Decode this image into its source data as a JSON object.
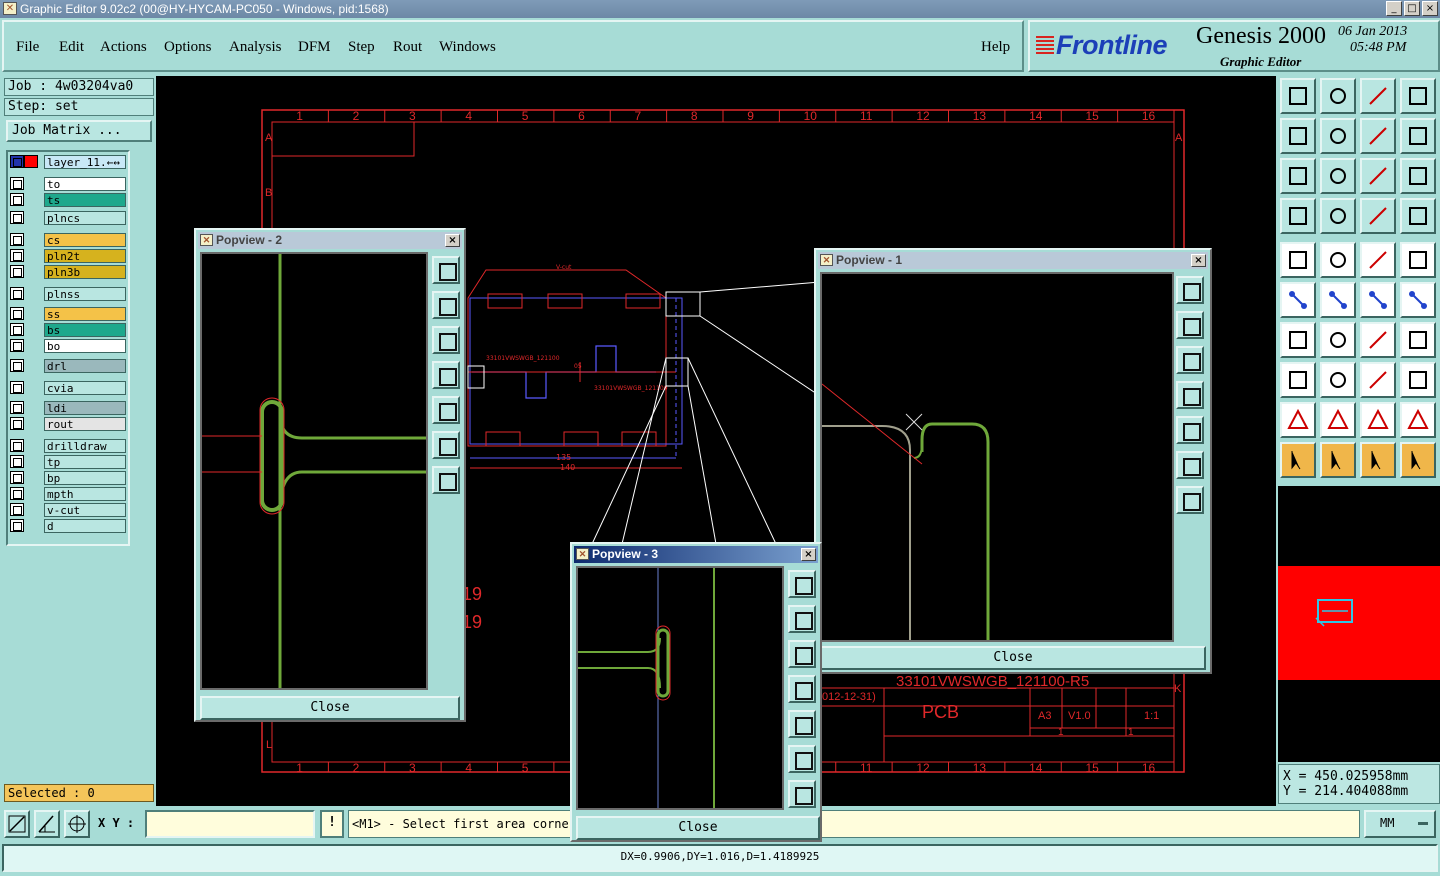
{
  "window": {
    "title": "Graphic Editor 9.02c2 (00@HY-HYCAM-PC050 - Windows, pid:1568)",
    "controls": [
      "_",
      "□",
      "×"
    ]
  },
  "menu": {
    "file": "File",
    "edit": "Edit",
    "actions": "Actions",
    "options": "Options",
    "analysis": "Analysis",
    "dfm": "DFM",
    "step": "Step",
    "rout": "Rout",
    "windows": "Windows",
    "help": "Help"
  },
  "brand": {
    "logo": "Frontline",
    "product": "Genesis 2000",
    "subtitle": "Graphic Editor",
    "date": "06 Jan 2013",
    "time": "05:48 PM"
  },
  "job": {
    "job_label": "Job : 4w03204va0",
    "step_label": "Step: set",
    "matrix_button": "Job Matrix ..."
  },
  "layers": [
    {
      "name": "layer_11.←↔",
      "color": "#c8e8f6"
    },
    {
      "name": "to",
      "color": "#ffffff"
    },
    {
      "name": "ts",
      "color": "#1ea88c"
    },
    {
      "name": "plncs",
      "color": "#b9e6e1"
    },
    {
      "name": "cs",
      "color": "#f4c248"
    },
    {
      "name": "pln2t",
      "color": "#d6b21e"
    },
    {
      "name": "pln3b",
      "color": "#d6b21e"
    },
    {
      "name": "plnss",
      "color": "#b9e6e1"
    },
    {
      "name": "ss",
      "color": "#f4c248"
    },
    {
      "name": "bs",
      "color": "#1ea88c"
    },
    {
      "name": "bo",
      "color": "#ffffff"
    },
    {
      "name": "drl",
      "color": "#9ab8bc"
    },
    {
      "name": "cvia",
      "color": "#b9e6e1"
    },
    {
      "name": "ldi",
      "color": "#9ab8bc"
    },
    {
      "name": "rout",
      "color": "#e4e4e4"
    },
    {
      "name": "drilldraw",
      "color": "#b9e6e1"
    },
    {
      "name": "tp",
      "color": "#b9e6e1"
    },
    {
      "name": "bp",
      "color": "#b9e6e1"
    },
    {
      "name": "mpth",
      "color": "#b9e6e1"
    },
    {
      "name": "v-cut",
      "color": "#b9e6e1"
    },
    {
      "name": "d",
      "color": "#b9e6e1"
    }
  ],
  "status": {
    "selected": "Selected : 0",
    "xy_label": "X Y :",
    "xy_value": "",
    "exclaim": "!",
    "prompt": "<M1> - Select first area corner",
    "units": "MM",
    "measure": "DX=0.9906,DY=1.016,D=1.4189925"
  },
  "coords": {
    "x": "X  =  450.025958mm",
    "y": "Y  =  214.404088mm"
  },
  "drawing": {
    "columns": [
      "1",
      "2",
      "3",
      "4",
      "5",
      "6",
      "7",
      "8",
      "9",
      "10",
      "11",
      "12",
      "13",
      "14",
      "15",
      "16"
    ],
    "bottom_columns": [
      "1",
      "2",
      "3",
      "4",
      "5",
      "11",
      "12",
      "13",
      "14",
      "15",
      "16"
    ],
    "rows_left": [
      "A",
      "B"
    ],
    "rows_right": [
      "A",
      "K"
    ],
    "title_block": {
      "part": "33101VWSWGB_121100-R5",
      "name": "PCB",
      "size": "A3",
      "rev": "V1.0",
      "scale": "1:1",
      "date": "012-12-31)",
      "one_a": "1",
      "one_b": "1"
    },
    "dims": {
      "d1": "135",
      "d2": "140"
    },
    "board_labels": [
      "V-cut",
      "33101VWSWGB_121100",
      "33101VWSWGB_121100",
      "05"
    ],
    "misc": [
      "19",
      "19"
    ]
  },
  "popups": [
    {
      "title": "Popview - 2",
      "close": "Close"
    },
    {
      "title": "Popview - 1",
      "close": "Close"
    },
    {
      "title": "Popview - 3",
      "close": "Close"
    }
  ],
  "colors": {
    "background": "#a7dcd6",
    "canvas": "#000000",
    "drawing": "#e0282a",
    "board": "#5a5aff",
    "trace": "#6fa83a"
  }
}
